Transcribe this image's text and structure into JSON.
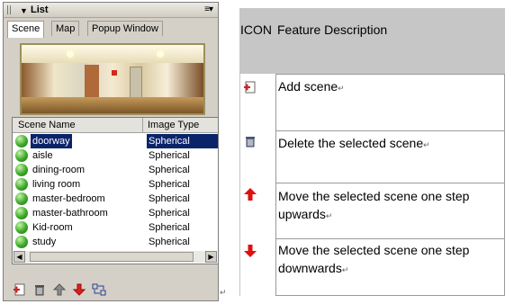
{
  "panel": {
    "title": "List",
    "tabs": [
      "Scene",
      "Map",
      "Popup Window"
    ],
    "columns": {
      "name": "Scene Name",
      "type": "Image Type"
    },
    "rows": [
      {
        "name": "doorway",
        "type": "Spherical",
        "selected": true
      },
      {
        "name": "aisle",
        "type": "Spherical"
      },
      {
        "name": "dining-room",
        "type": "Spherical"
      },
      {
        "name": "living room",
        "type": "Spherical"
      },
      {
        "name": "master-bedroom",
        "type": "Spherical"
      },
      {
        "name": "master-bathroom",
        "type": "Spherical"
      },
      {
        "name": "Kid-room",
        "type": "Spherical"
      },
      {
        "name": "study",
        "type": "Spherical"
      }
    ],
    "toolbar_icons": [
      "add-scene-icon",
      "delete-scene-icon",
      "move-up-icon",
      "move-down-icon",
      "swap-icon"
    ]
  },
  "table": {
    "header_icon": "ICON",
    "header_feature": "Feature Description",
    "rows": [
      {
        "icon": "add-scene-icon",
        "text": "Add scene"
      },
      {
        "icon": "trash-icon",
        "text": "Delete the selected scene"
      },
      {
        "icon": "red-up-arrow-icon",
        "text": "Move the selected scene one step upwards"
      },
      {
        "icon": "red-down-arrow-icon",
        "text": "Move the selected scene one step downwards"
      }
    ],
    "paragraph_mark": "↵"
  }
}
